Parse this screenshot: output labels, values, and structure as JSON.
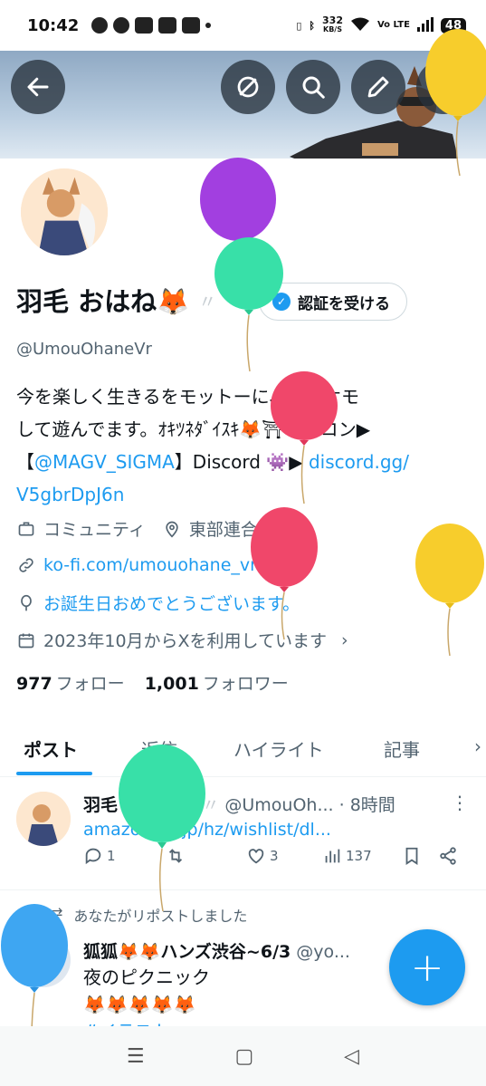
{
  "status_bar": {
    "time": "10:42",
    "net_speed": "332",
    "net_unit": "KB/S",
    "volte": "Vo LTE",
    "battery": "48"
  },
  "header": {
    "back_icon": "arrow-left-icon",
    "grok_icon": "slash-circle-icon",
    "search_icon": "search-icon",
    "edit_icon": "pencil-icon"
  },
  "profile": {
    "display_name": "羽毛 おはね🦊",
    "verify_label": "認証を受ける",
    "handle": "@UmouOhaneVr",
    "bio_line1": "今を楽しく生きるをモットーに、ケモケモ",
    "bio_line2": "して遊んでます。ｵｷﾂﾈﾀﾞｲｽｷ🦊⛩アイコン▶",
    "bio_line3_pre": "【",
    "bio_mention": "@MAGV_SIGMA",
    "bio_line3_mid": "】Discord 👾▶",
    "bio_link": "discord.gg/",
    "bio_line4": "V5gbrDpJ6n",
    "category": "コミュニティ",
    "location": "東部連合NGNR",
    "website": "ko-fi.com/umouohane_vr",
    "birthday": "お誕生日おめでとうございます。",
    "joined": "2023年10月からXを利用しています",
    "following_count": "977",
    "following_label": "フォロー",
    "followers_count": "1,001",
    "followers_label": "フォロワー"
  },
  "tabs": [
    "ポスト",
    "返信",
    "ハイライト",
    "記事"
  ],
  "posts": [
    {
      "name": "羽毛 おはね🦊",
      "handle": "@UmouOh...",
      "time": "· 8時間",
      "link": "amazon.co.jp/hz/wishlist/dl...",
      "replies": "1",
      "likes": "3",
      "views": "137"
    },
    {
      "repost_label": "あなたがリポストしました",
      "name": "狐狐🦊🦊ハンズ渋谷~6/3",
      "handle": "@yo...",
      "text_line1": "夜のピクニック",
      "text_line2": "🦊🦊🦊🦊🦊",
      "text_line3": "#イラスト"
    }
  ],
  "fab_label": "+",
  "nav": [
    "☰",
    "▢",
    "◁"
  ],
  "colors": {
    "accent": "#1d9bf0",
    "text": "#0f1419",
    "secondary": "#536471"
  }
}
